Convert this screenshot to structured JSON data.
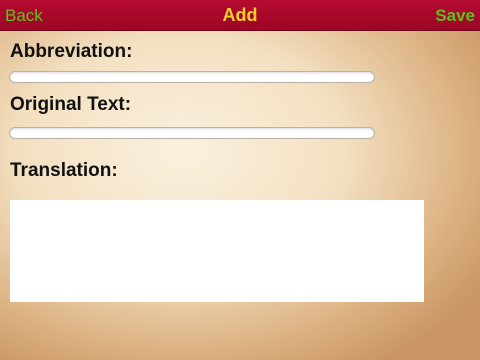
{
  "navbar": {
    "back_label": "Back",
    "title": "Add",
    "save_label": "Save"
  },
  "form": {
    "abbreviation_label": "Abbreviation:",
    "abbreviation_value": "",
    "original_text_label": "Original Text:",
    "original_text_value": "",
    "translation_label": "Translation:",
    "translation_value": ""
  },
  "colors": {
    "navbar_bg": "#a8082a",
    "nav_button": "#5fc01f",
    "nav_title": "#f3d12a"
  }
}
